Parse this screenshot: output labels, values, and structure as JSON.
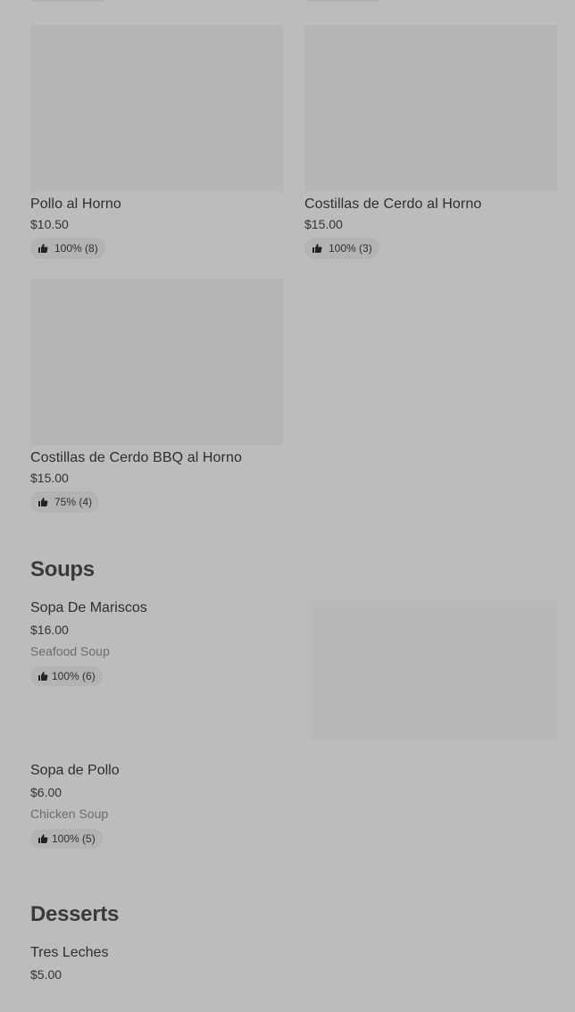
{
  "grid_items": [
    {
      "name": "Pollo al Horno",
      "price": "$10.50",
      "rating": "100% (8)"
    },
    {
      "name": "Costillas de Cerdo al Horno",
      "price": "$15.00",
      "rating": "100% (3)"
    },
    {
      "name": "Costillas de Cerdo BBQ al Horno",
      "price": "$15.00",
      "rating": "75% (4)"
    }
  ],
  "soups": {
    "title": "Soups",
    "items": [
      {
        "name": "Sopa De Mariscos",
        "price": "$16.00",
        "description": "Seafood Soup",
        "rating": "100% (6)"
      },
      {
        "name": "Sopa de Pollo",
        "price": "$6.00",
        "description": "Chicken Soup",
        "rating": "100% (5)"
      }
    ]
  },
  "desserts": {
    "title": "Desserts",
    "items": [
      {
        "name": "Tres Leches",
        "price": "$5.00"
      }
    ]
  },
  "icons": {
    "rating": "thumbs-up-icon"
  }
}
